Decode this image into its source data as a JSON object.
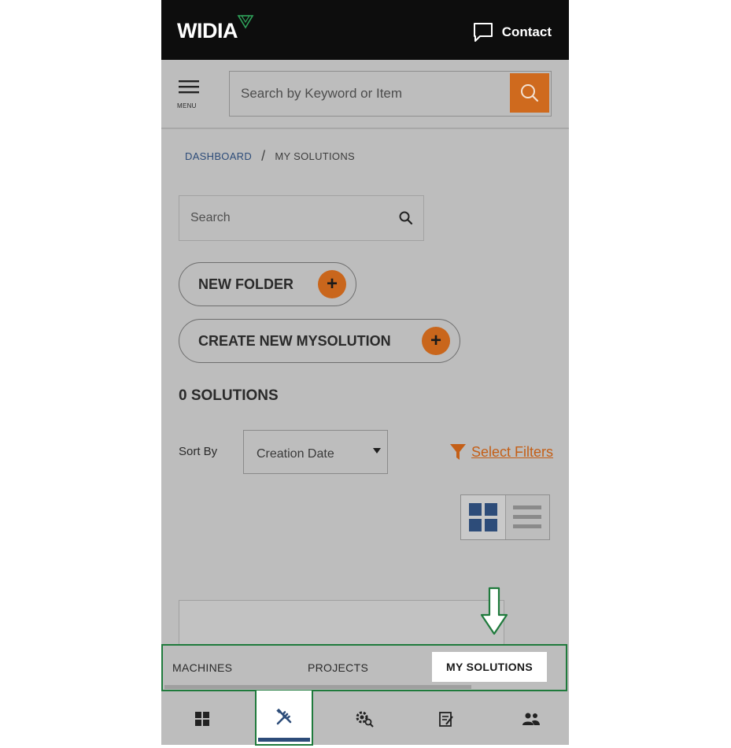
{
  "header": {
    "logo_text": "WIDIA",
    "contact_label": "Contact"
  },
  "searchbar": {
    "menu_label": "MENU",
    "placeholder": "Search by Keyword or Item"
  },
  "breadcrumb": {
    "items": [
      "DASHBOARD",
      "MY SOLUTIONS"
    ],
    "separator": "/"
  },
  "solutions_search": {
    "placeholder": "Search"
  },
  "actions": {
    "new_folder": "NEW FOLDER",
    "create_new": "CREATE NEW MYSOLUTION",
    "plus": "+"
  },
  "results": {
    "count_label": "0 SOLUTIONS"
  },
  "sort": {
    "label": "Sort By",
    "selected": "Creation Date"
  },
  "filters": {
    "label": "Select Filters"
  },
  "tabs": {
    "items": [
      "MACHINES",
      "PROJECTS",
      "MY SOLUTIONS"
    ],
    "active": "MY SOLUTIONS"
  },
  "bottom_nav": {
    "items": [
      "dashboard-icon",
      "tools-icon",
      "gear-search-icon",
      "report-icon",
      "users-icon"
    ],
    "active": "tools-icon"
  },
  "colors": {
    "accent": "#cf6a1e",
    "link": "#2d4c79",
    "highlight": "#1f7a3c",
    "header_bg": "#0d0d0d",
    "overlay_bg": "#bdbdbd"
  }
}
